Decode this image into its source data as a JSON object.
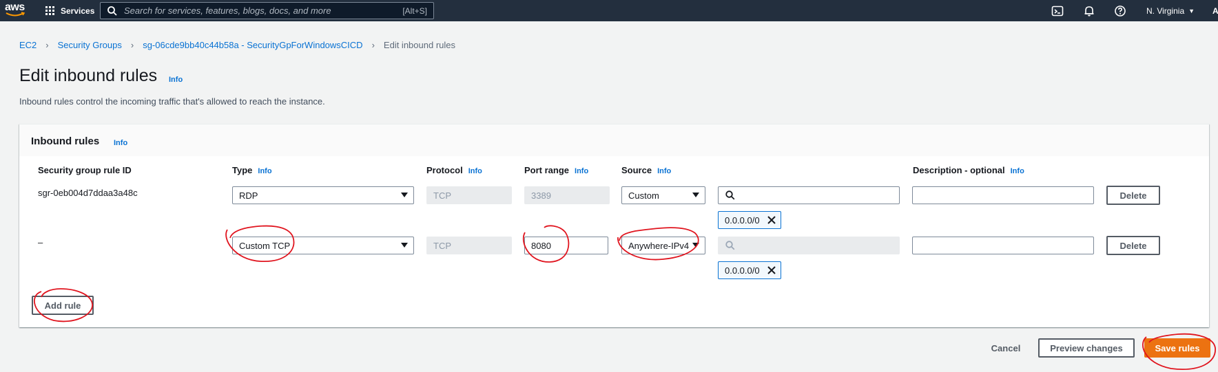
{
  "topnav": {
    "logo_text": "aws",
    "services_label": "Services",
    "search_placeholder": "Search for services, features, blogs, docs, and more",
    "search_shortcut": "[Alt+S]",
    "region_label": "N. Virginia",
    "account_initial": "A"
  },
  "breadcrumb": {
    "items": [
      "EC2",
      "Security Groups",
      "sg-06cde9bb40c44b58a - SecurityGpForWindowsCICD"
    ],
    "current": "Edit inbound rules"
  },
  "page": {
    "title": "Edit inbound rules",
    "info": "Info",
    "description": "Inbound rules control the incoming traffic that's allowed to reach the instance."
  },
  "panel": {
    "title": "Inbound rules",
    "info": "Info",
    "columns": {
      "rule_id": "Security group rule ID",
      "type": "Type",
      "protocol": "Protocol",
      "port_range": "Port range",
      "source": "Source",
      "description": "Description - optional",
      "info": "Info"
    },
    "rows": [
      {
        "rule_id": "sgr-0eb004d7ddaa3a48c",
        "type": "RDP",
        "protocol": "TCP",
        "port_range": "3389",
        "source": "Custom",
        "source_search": "",
        "cidr_token": "0.0.0.0/0",
        "description": "",
        "delete_label": "Delete"
      },
      {
        "rule_id": "–",
        "type": "Custom TCP",
        "protocol": "TCP",
        "port_range": "8080",
        "source": "Anywhere-IPv4",
        "source_search": "",
        "cidr_token": "0.0.0.0/0",
        "description": "",
        "delete_label": "Delete"
      }
    ],
    "add_rule_label": "Add rule"
  },
  "footer": {
    "cancel_label": "Cancel",
    "preview_label": "Preview changes",
    "save_label": "Save rules"
  },
  "colors": {
    "nav_bg": "#232f3e",
    "link": "#0972d3",
    "primary": "#ec7211",
    "annotation": "#e0141e"
  }
}
